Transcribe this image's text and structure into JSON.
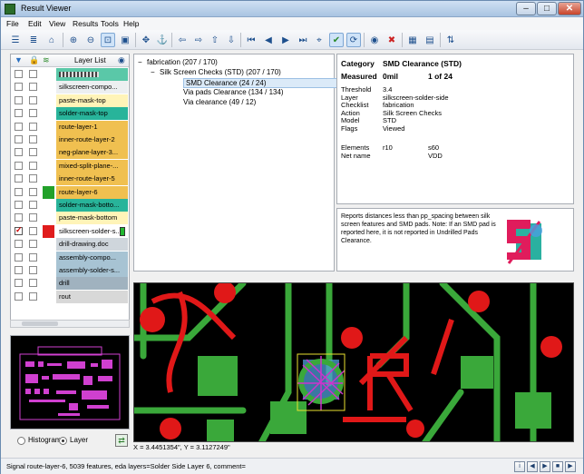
{
  "window": {
    "title": "Result Viewer"
  },
  "menu": [
    "File",
    "Edit",
    "View",
    "Results",
    "Tools",
    "Help"
  ],
  "layer_panel": {
    "header": "Layer List",
    "layers": [
      {
        "name": "",
        "color": "#5ac8a8",
        "checked": false,
        "swatch": "",
        "is_bar": true
      },
      {
        "name": "silkscreen-compo...",
        "color": "#eceff1",
        "checked": false,
        "swatch": ""
      },
      {
        "name": "paste-mask-top",
        "color": "#fff4b8",
        "checked": false,
        "swatch": ""
      },
      {
        "name": "solder-mask-top",
        "color": "#28b49a",
        "checked": false,
        "swatch": ""
      },
      {
        "name": "route-layer-1",
        "color": "#f0c050",
        "checked": false,
        "swatch": ""
      },
      {
        "name": "inner-route-layer-2",
        "color": "#f0c050",
        "checked": false,
        "swatch": ""
      },
      {
        "name": "neg-plane-layer-3...",
        "color": "#f0c050",
        "checked": false,
        "swatch": ""
      },
      {
        "name": "mixed-split-plane-...",
        "color": "#f0c050",
        "checked": false,
        "swatch": ""
      },
      {
        "name": "inner-route-layer-5",
        "color": "#f0c050",
        "checked": false,
        "swatch": ""
      },
      {
        "name": "route-layer-6",
        "color": "#f0c050",
        "checked": false,
        "swatch": "#22a12a"
      },
      {
        "name": "solder-mask-botto...",
        "color": "#28b49a",
        "checked": false,
        "swatch": ""
      },
      {
        "name": "paste-mask-bottom",
        "color": "#fff4b8",
        "checked": false,
        "swatch": ""
      },
      {
        "name": "silkscreen-solder-s...",
        "color": "#ffffff",
        "checked": true,
        "swatch": "#e01c1c"
      },
      {
        "name": "drill-drawing.doc",
        "color": "#cfd6dc",
        "checked": false,
        "swatch": ""
      },
      {
        "name": "assembly-compo...",
        "color": "#a7c3d3",
        "checked": false,
        "swatch": ""
      },
      {
        "name": "assembly-solder-s...",
        "color": "#a7c3d3",
        "checked": false,
        "swatch": ""
      },
      {
        "name": "drill",
        "color": "#a0b2bf",
        "checked": false,
        "swatch": ""
      },
      {
        "name": "rout",
        "color": "#d8d8d8",
        "checked": false,
        "swatch": ""
      }
    ]
  },
  "view_options": {
    "histogram": "Histogram",
    "layer": "Layer",
    "selected": "Layer"
  },
  "tree": [
    {
      "label": "fabrication (207 / 170)",
      "level": 0,
      "expander": "−"
    },
    {
      "label": "Silk Screen Checks (STD) (207 / 170)",
      "level": 1,
      "expander": "−"
    },
    {
      "label": "SMD Clearance (24 / 24)",
      "level": 2,
      "selected": true
    },
    {
      "label": "Via pads Clearance (134 / 134)",
      "level": 2
    },
    {
      "label": "Via clearance (49 / 12)",
      "level": 2
    }
  ],
  "details": {
    "category_label": "Category",
    "category_value": "SMD Clearance  (STD)",
    "measured_label": "Measured",
    "measured_value": "0mil",
    "index": "1 of 24",
    "props": [
      {
        "k": "Threshold",
        "v": "3.4"
      },
      {
        "k": "Layer",
        "v": "silkscreen-solder-side"
      },
      {
        "k": "Checklist",
        "v": "fabrication"
      },
      {
        "k": "Action",
        "v": "Silk Screen Checks"
      },
      {
        "k": "Model",
        "v": "STD"
      },
      {
        "k": "Flags",
        "v": "Viewed"
      }
    ],
    "elements_label": "Elements",
    "elements_a": "r10",
    "elements_b": "s60",
    "net_label": "Net name",
    "net_value": "VDD"
  },
  "description": "Reports distances less than pp_spacing between silk screen features and SMD pads. Note: If an SMD pad is reported here, it is not reported in Undrilled Pads Clearance.",
  "coords": "X = 3.4451354\", Y = 3.1127249\"",
  "status": "Signal route-layer-6, 5039 features, eda layers=Solder Side Layer 6, comment=",
  "colors": {
    "pcb_green": "#3aa83a",
    "pcb_red": "#e01818",
    "highlight": "#cc33cc",
    "selection": "#dbeaf8"
  }
}
